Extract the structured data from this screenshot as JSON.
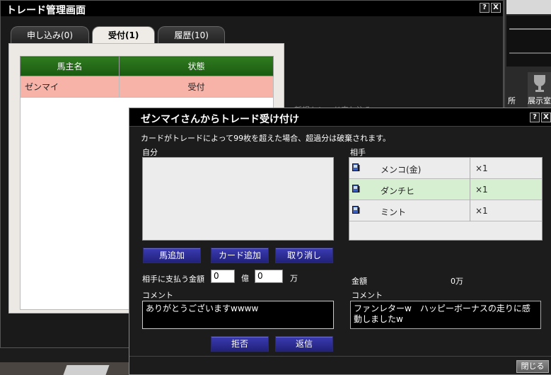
{
  "manager": {
    "title": "トレード管理画面",
    "help_label": "?",
    "close_label": "X",
    "tabs": [
      {
        "label": "申し込み(0)",
        "active": false
      },
      {
        "label": "受付(1)",
        "active": true
      },
      {
        "label": "履歴(10)",
        "active": false
      }
    ],
    "table": {
      "columns": [
        "馬主名",
        "状態"
      ],
      "rows": [
        {
          "owner": "ゼンマイ",
          "status": "受付"
        }
      ]
    },
    "note": "新規トレード申し込み"
  },
  "dialog": {
    "title": "ゼンマイさんからトレード受け付け",
    "help_label": "?",
    "close_label": "X",
    "warning": "カードがトレードによって99枚を超えた場合、超過分は破棄されます。",
    "self_label": "自分",
    "partner_label": "相手",
    "partner_cards": [
      {
        "name": "メンコ(金)",
        "qty": "×1",
        "highlight": false
      },
      {
        "name": "ダンチヒ",
        "qty": "×1",
        "highlight": true
      },
      {
        "name": "ミント",
        "qty": "×1",
        "highlight": false
      }
    ],
    "buttons": {
      "add_horse": "馬追加",
      "add_card": "カード追加",
      "cancel": "取り消し",
      "reject": "拒否",
      "reply": "返信",
      "close": "閉じる"
    },
    "payment": {
      "label": "相手に支払う金額",
      "oku_value": "0",
      "oku_unit": "億",
      "man_value": "0",
      "man_unit": "万"
    },
    "partner_amount": {
      "label": "金額",
      "value": "0万"
    },
    "my_comment": {
      "label": "コメント",
      "value": "ありがとうございますwwww"
    },
    "partner_comment": {
      "label": "コメント",
      "value": "ファンレターw　ハッピーボーナスの走りに感動しましたw"
    }
  },
  "background": {
    "right_labels": [
      "所",
      "展示室"
    ]
  }
}
